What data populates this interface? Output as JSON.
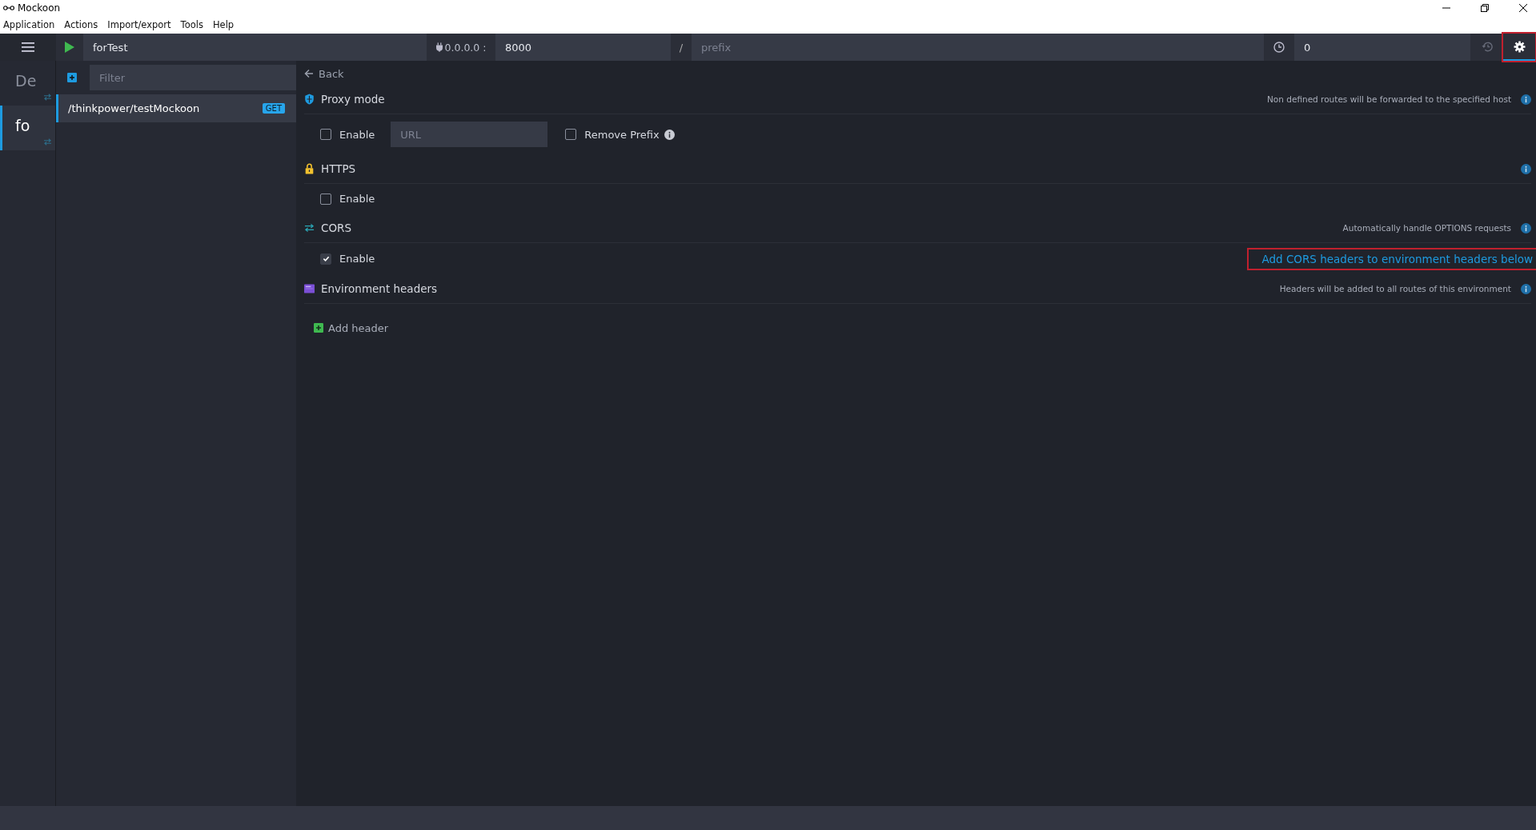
{
  "window": {
    "title": "Mockoon"
  },
  "menu": [
    "Application",
    "Actions",
    "Import/export",
    "Tools",
    "Help"
  ],
  "toolbar": {
    "environment_name": "forTest",
    "host_label": "0.0.0.0 :",
    "port": "8000",
    "separator": "/",
    "prefix_placeholder": "prefix",
    "latency": "0",
    "tabs": [
      {
        "kind": "history",
        "selected": false,
        "highlighted": false
      },
      {
        "kind": "settings",
        "selected": true,
        "highlighted": true
      }
    ]
  },
  "environments": [
    {
      "label": "De",
      "selected": false
    },
    {
      "label": "fo",
      "selected": true
    }
  ],
  "routes": {
    "filter_placeholder": "Filter",
    "items": [
      {
        "path": "/thinkpower/testMockoon",
        "method": "GET",
        "selected": true
      }
    ]
  },
  "settings": {
    "back": "Back",
    "sections": [
      {
        "kind": "proxy",
        "title": "Proxy mode",
        "note": "Non defined routes will be forwarded to the specified host",
        "enable_label": "Enable",
        "enabled": false,
        "url_placeholder": "URL",
        "remove_prefix_label": "Remove Prefix",
        "remove_prefix": false
      },
      {
        "kind": "https",
        "title": "HTTPS",
        "enable_label": "Enable",
        "enabled": false
      },
      {
        "kind": "cors",
        "title": "CORS",
        "note": "Automatically handle OPTIONS requests",
        "enable_label": "Enable",
        "enabled": true,
        "link": "Add CORS headers to environment headers below",
        "link_highlighted": true
      },
      {
        "kind": "headers",
        "title": "Environment headers",
        "note": "Headers will be added to all routes of this environment",
        "add_label": "Add header"
      }
    ]
  }
}
